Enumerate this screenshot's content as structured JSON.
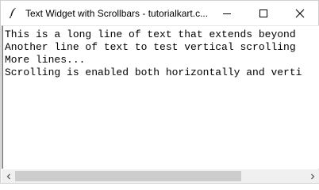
{
  "window": {
    "title": "Text Widget with Scrollbars - tutorialkart.c...",
    "icon": "feather-icon"
  },
  "controls": {
    "minimize_icon": "minimize-icon",
    "maximize_icon": "maximize-icon",
    "close_icon": "close-icon"
  },
  "text": {
    "lines": [
      "This is a long line of text that extends beyond",
      "Another line of text to test vertical scrolling",
      "More lines...",
      "Scrolling is enabled both horizontally and verti"
    ]
  },
  "scrollbar": {
    "left_icon": "chevron-left-icon",
    "right_icon": "chevron-right-icon",
    "thumb_fraction": 0.78,
    "thumb_position": 0.0
  },
  "colors": {
    "window_bg": "#ffffff",
    "scroll_track": "#f0f0f0",
    "scroll_thumb": "#cdcdcd"
  }
}
